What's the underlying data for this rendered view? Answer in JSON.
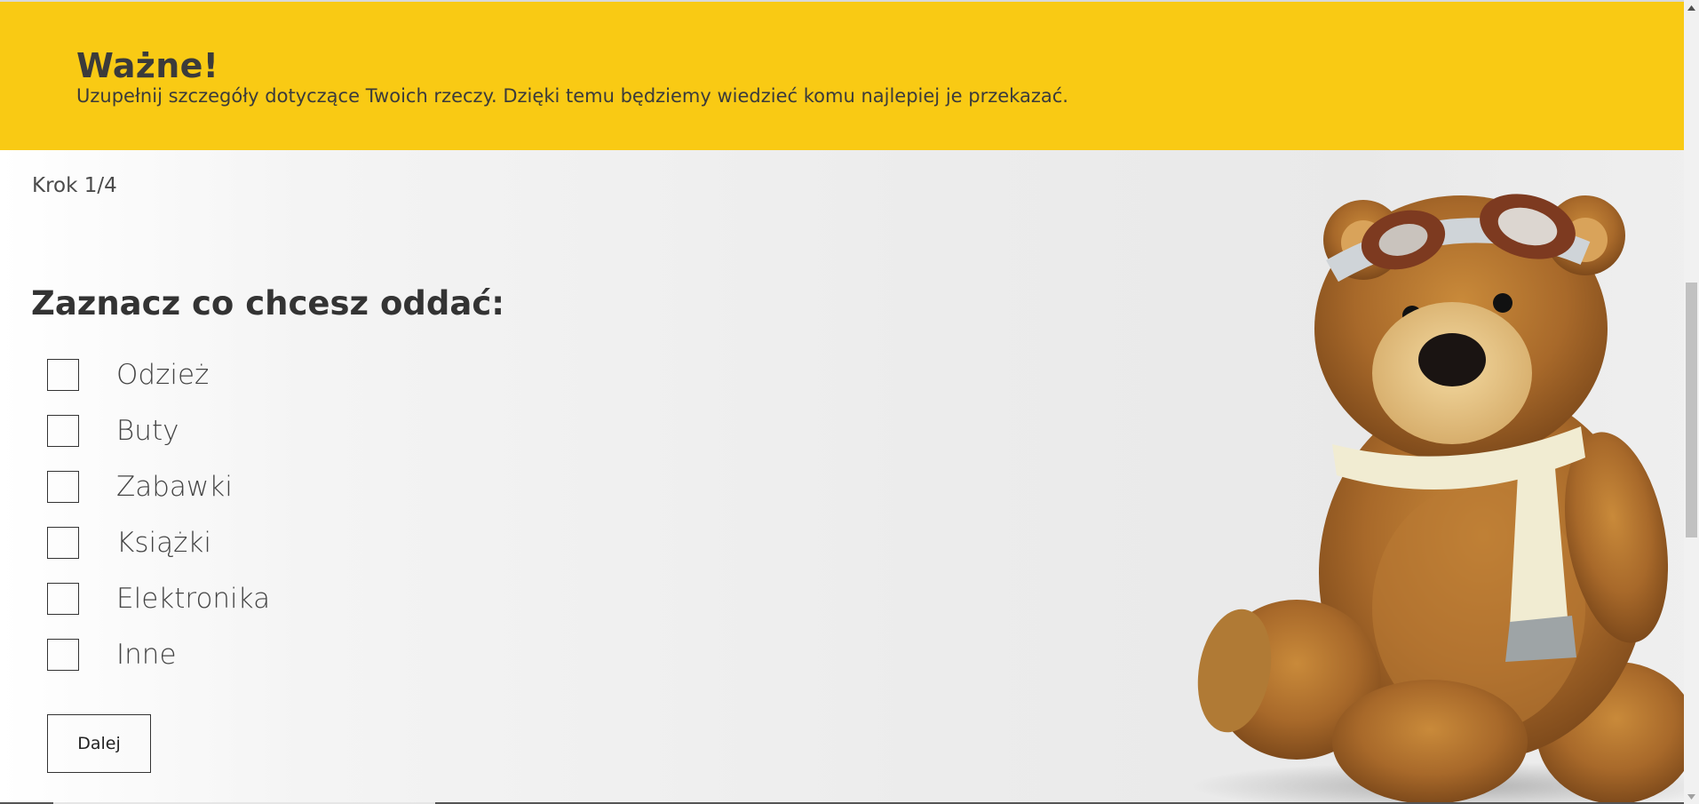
{
  "banner": {
    "title": "Ważne!",
    "text": "Uzupełnij szczegóły dotyczące Twoich rzeczy. Dzięki temu będziemy wiedzieć komu najlepiej je przekazać.",
    "background_color": "#f9ca14"
  },
  "form": {
    "step_label": "Krok 1/4",
    "heading": "Zaznacz co chcesz oddać:",
    "options": [
      {
        "label": "Odzież",
        "checked": false
      },
      {
        "label": "Buty",
        "checked": false
      },
      {
        "label": "Zabawki",
        "checked": false
      },
      {
        "label": "Książki",
        "checked": false
      },
      {
        "label": "Elektronika",
        "checked": false
      },
      {
        "label": "Inne",
        "checked": false
      }
    ],
    "next_button": "Dalej"
  },
  "illustration": {
    "icon": "teddy-bear-image"
  }
}
